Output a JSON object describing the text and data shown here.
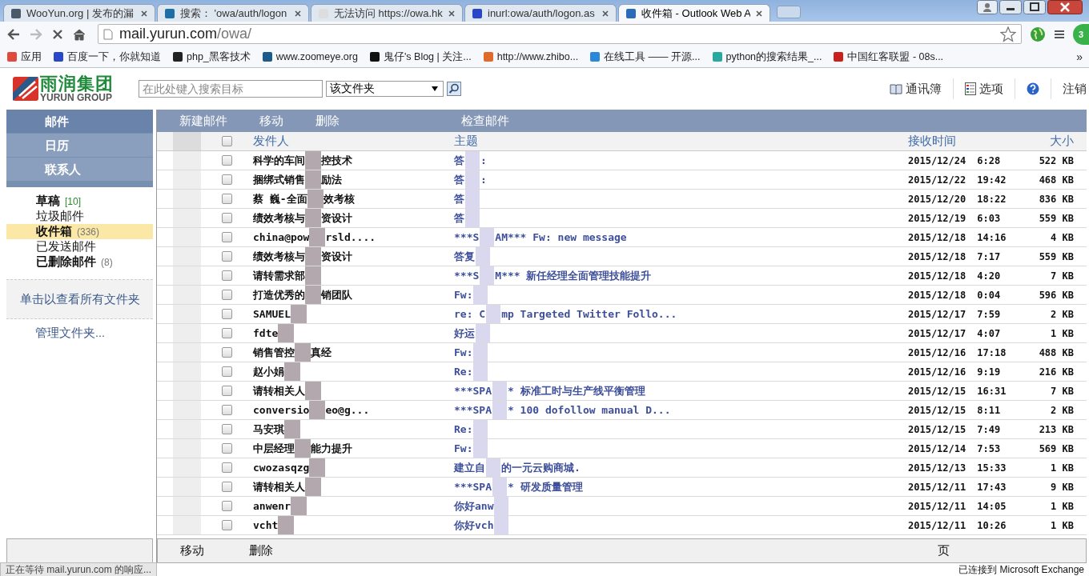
{
  "browser": {
    "tabs": [
      {
        "title": "WooYun.org | 发布的漏",
        "selected": false,
        "color": "#4a5a6a"
      },
      {
        "title": "搜索： 'owa/auth/logon",
        "selected": false,
        "color": "#1d6fa5"
      },
      {
        "title": "无法访问 https://owa.hk",
        "selected": false,
        "color": "#dddddd"
      },
      {
        "title": "inurl:owa/auth/logon.as",
        "selected": false,
        "color": "#2b45c8"
      },
      {
        "title": "收件箱 - Outlook Web A",
        "selected": true,
        "color": "#2a6ab8"
      }
    ],
    "address": {
      "host": "mail.yurun.com",
      "path": "/owa/"
    },
    "extension_badge": "3",
    "bookmarks": [
      {
        "label": "应用",
        "color": "#e04a3a"
      },
      {
        "label": "百度一下，你就知道",
        "color": "#2a47c8"
      },
      {
        "label": "php_黑客技术",
        "color": "#222222"
      },
      {
        "label": "www.zoomeye.org",
        "color": "#1b5a8a"
      },
      {
        "label": "鬼仔's Blog | 关注...",
        "color": "#111111"
      },
      {
        "label": "http://www.zhibo...",
        "color": "#e06a2a"
      },
      {
        "label": "在线工具 —— 开源...",
        "color": "#2a88d8"
      },
      {
        "label": "python的搜索结果_...",
        "color": "#2aa8a0"
      },
      {
        "label": "中国红客联盟 - 08s...",
        "color": "#c8201a"
      }
    ],
    "bookmarks_more": "»",
    "status_left": "正在等待 mail.yurun.com 的响应...",
    "status_right": "已连接到 Microsoft Exchange"
  },
  "header": {
    "logo_cn": "雨润集团",
    "logo_en": "YURUN GROUP",
    "search": {
      "placeholder": "在此处键入搜索目标"
    },
    "scope": "该文件夹",
    "links": [
      {
        "kind": "book",
        "label": "通讯簿"
      },
      {
        "kind": "options",
        "label": "选项"
      },
      {
        "kind": "help"
      },
      {
        "kind": "plain",
        "label": "注销"
      }
    ]
  },
  "nav": [
    {
      "label": "邮件",
      "selected": true
    },
    {
      "label": "日历",
      "selected": false
    },
    {
      "label": "联系人",
      "selected": false
    }
  ],
  "folders": [
    {
      "label": "草稿",
      "count": "[10]",
      "bold": true,
      "selected": false
    },
    {
      "label": "垃圾邮件",
      "bold": false,
      "selected": false
    },
    {
      "label": "收件箱",
      "count": "(336)",
      "bold": true,
      "selected": true
    },
    {
      "label": "已发送邮件",
      "bold": false,
      "selected": false
    },
    {
      "label": "已删除邮件",
      "count": "(8)",
      "bold": true,
      "selected": false
    }
  ],
  "all_folders_link": "单击以查看所有文件夹",
  "manage_folders_link": "管理文件夹...",
  "toolbar": [
    "新建邮件",
    "移动",
    "删除",
    "检查邮件"
  ],
  "table": {
    "columns": {
      "sender": "发件人",
      "subject": "主题",
      "received": "接收时间",
      "size": "大小"
    },
    "header_checked": false,
    "rows": [
      {
        "sender": [
          "科学的车间",
          "控技术"
        ],
        "subject": [
          "答",
          ":"
        ],
        "date": "2015/12/24",
        "time": "6:28",
        "size": "522 KB",
        "checked": false
      },
      {
        "sender": [
          "捆绑式销售",
          "励法"
        ],
        "subject": [
          "答",
          ":"
        ],
        "date": "2015/12/22",
        "time": "19:42",
        "size": "468 KB",
        "checked": false
      },
      {
        "sender": [
          "蔡 巍-全面",
          "效考核"
        ],
        "subject": [
          "答"
        ],
        "date": "2015/12/20",
        "time": "18:22",
        "size": "836 KB",
        "checked": false
      },
      {
        "sender": [
          "绩效考核与",
          "资设计"
        ],
        "subject": [
          "答"
        ],
        "date": "2015/12/19",
        "time": "6:03",
        "size": "559 KB",
        "checked": false
      },
      {
        "sender": [
          "china@pow",
          "rsld...."
        ],
        "subject": [
          "***S",
          "AM*** Fw: new message"
        ],
        "date": "2015/12/18",
        "time": "14:16",
        "size": "4 KB",
        "checked": false
      },
      {
        "sender": [
          "绩效考核与",
          "资设计"
        ],
        "subject": [
          "答复"
        ],
        "date": "2015/12/18",
        "time": "7:17",
        "size": "559 KB",
        "checked": false
      },
      {
        "sender": [
          "请转需求部"
        ],
        "subject": [
          "***S",
          "M*** 新任经理全面管理技能提升"
        ],
        "date": "2015/12/18",
        "time": "4:20",
        "size": "7 KB",
        "checked": false
      },
      {
        "sender": [
          "打造优秀的",
          "销团队"
        ],
        "subject": [
          "Fw:"
        ],
        "date": "2015/12/18",
        "time": "0:04",
        "size": "596 KB",
        "checked": false
      },
      {
        "sender": [
          "SAMUEL"
        ],
        "subject": [
          "re: C",
          "mp Targeted Twitter Follo..."
        ],
        "date": "2015/12/17",
        "time": "7:59",
        "size": "2 KB",
        "checked": false
      },
      {
        "sender": [
          "fdte"
        ],
        "subject": [
          "好运"
        ],
        "date": "2015/12/17",
        "time": "4:07",
        "size": "1 KB",
        "checked": false
      },
      {
        "sender": [
          "销售管控",
          "真经"
        ],
        "subject": [
          "Fw:"
        ],
        "date": "2015/12/16",
        "time": "17:18",
        "size": "488 KB",
        "checked": false
      },
      {
        "sender": [
          "赵小娟"
        ],
        "subject": [
          "Re:"
        ],
        "date": "2015/12/16",
        "time": "9:19",
        "size": "216 KB",
        "checked": false
      },
      {
        "sender": [
          "请转相关人"
        ],
        "subject": [
          "***SPA",
          "* 标准工时与生产线平衡管理"
        ],
        "date": "2015/12/15",
        "time": "16:31",
        "size": "7 KB",
        "checked": false
      },
      {
        "sender": [
          "conversio",
          "eo@g..."
        ],
        "subject": [
          "***SPA",
          "* 100 dofollow manual D..."
        ],
        "date": "2015/12/15",
        "time": "8:11",
        "size": "2 KB",
        "checked": false
      },
      {
        "sender": [
          "马安琪"
        ],
        "subject": [
          "Re:"
        ],
        "date": "2015/12/15",
        "time": "7:49",
        "size": "213 KB",
        "checked": false
      },
      {
        "sender": [
          "中层经理",
          "能力提升"
        ],
        "subject": [
          "Fw:"
        ],
        "date": "2015/12/14",
        "time": "7:53",
        "size": "569 KB",
        "checked": false
      },
      {
        "sender": [
          "cwozasqzg"
        ],
        "subject": [
          "建立自",
          "的一元云购商城."
        ],
        "date": "2015/12/13",
        "time": "15:33",
        "size": "1 KB",
        "checked": false
      },
      {
        "sender": [
          "请转相关人"
        ],
        "subject": [
          "***SPA",
          "* 研发质量管理"
        ],
        "date": "2015/12/11",
        "time": "17:43",
        "size": "9 KB",
        "checked": false
      },
      {
        "sender": [
          "anwenr"
        ],
        "subject": [
          "你好anw"
        ],
        "date": "2015/12/11",
        "time": "14:05",
        "size": "1 KB",
        "checked": false
      },
      {
        "sender": [
          "vcht"
        ],
        "subject": [
          "你好vch"
        ],
        "date": "2015/12/11",
        "time": "10:26",
        "size": "1 KB",
        "checked": false
      }
    ]
  },
  "bottom_toolbar": [
    "移动",
    "删除"
  ],
  "page_label": "页"
}
